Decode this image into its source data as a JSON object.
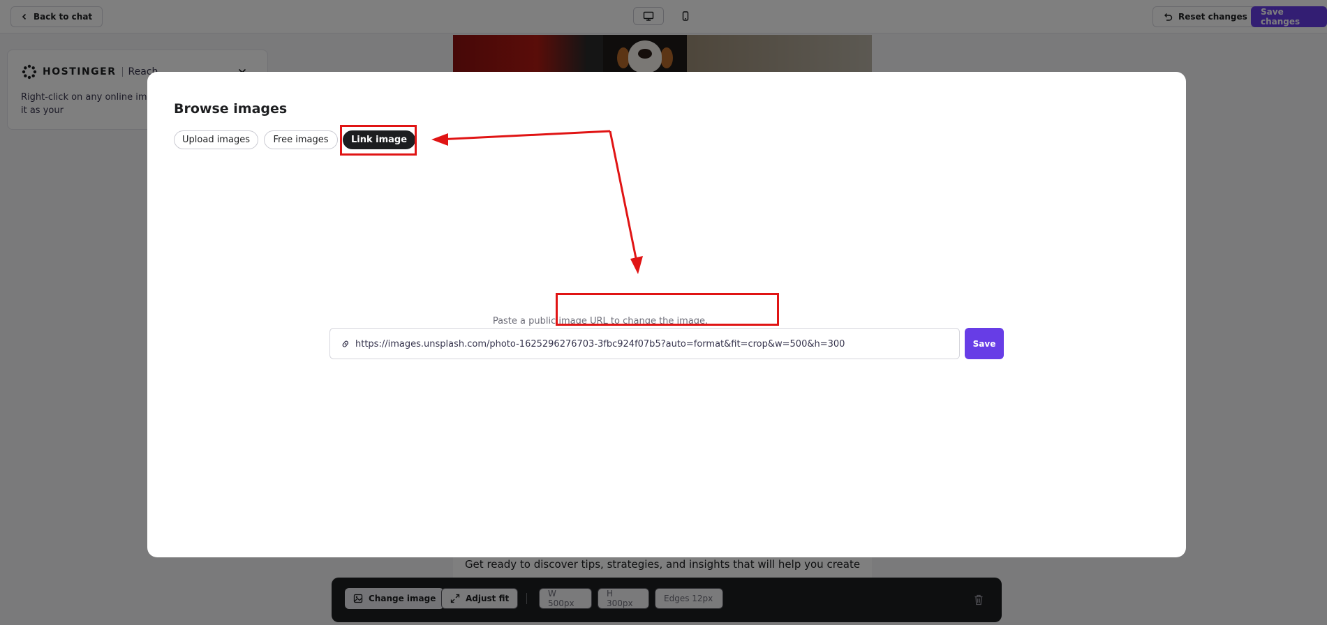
{
  "topbar": {
    "back_label": "Back to chat",
    "reset_label": "Reset changes",
    "save_label": "Save changes"
  },
  "reach_panel": {
    "brand_name": "HOSTINGER",
    "product": "Reach",
    "text": "Right-click on any online imag address, then paste it as your"
  },
  "canvas": {
    "body_text": "Get ready to discover tips, strategies, and insights that will help you create"
  },
  "toolbar": {
    "change_image_label": "Change image",
    "adjust_fit_label": "Adjust fit",
    "width": "W 500px",
    "height": "H 300px",
    "edges": "Edges 12px"
  },
  "modal": {
    "title": "Browse images",
    "tabs": [
      {
        "label": "Upload images",
        "active": false
      },
      {
        "label": "Free images",
        "active": false
      },
      {
        "label": "Link image",
        "active": true
      }
    ],
    "hint": "Paste a public image URL to change the image.",
    "url_value": "https://images.unsplash.com/photo-1625296276703-3fbc924f07b5?auto=format&fit=crop&w=500&h=300",
    "save_label": "Save"
  },
  "colors": {
    "accent": "#673de6",
    "annotation": "#e01414",
    "dark": "#1d1e20"
  },
  "icons": [
    "chevron-left-icon",
    "undo-icon",
    "desktop-icon",
    "mobile-icon",
    "hostinger-logo-icon",
    "chevron-down-icon",
    "image-icon",
    "expand-icon",
    "trash-icon",
    "link-icon"
  ]
}
